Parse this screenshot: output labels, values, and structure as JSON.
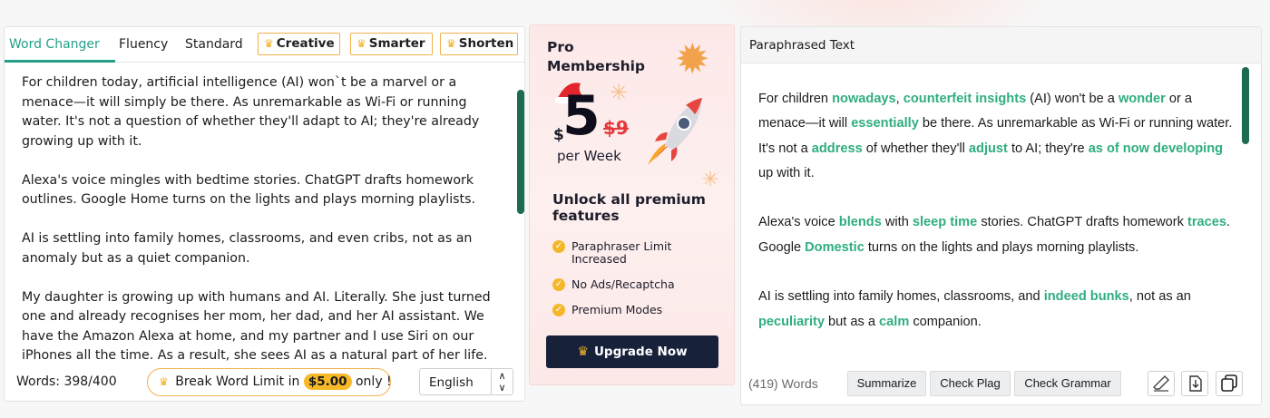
{
  "left": {
    "tabs": [
      {
        "label": "Word Changer",
        "active": true
      },
      {
        "label": "Fluency"
      },
      {
        "label": "Standard"
      },
      {
        "label": "Creative",
        "premium": true
      },
      {
        "label": "Smarter",
        "premium": true
      },
      {
        "label": "Shorten",
        "premium": true
      }
    ],
    "paragraphs": [
      "For children today, artificial intelligence (AI) won`t be a marvel or a menace—it will simply be there. As unremarkable as Wi-Fi or running water. It's not a question of whether they'll adapt to AI; they're already growing up with it.",
      "Alexa's voice mingles with bedtime stories. ChatGPT drafts homework outlines. Google Home turns on the lights and plays morning playlists.",
      "AI is settling into family homes, classrooms, and even cribs, not as an anomaly but as a quiet companion.",
      "My daughter is growing up with humans and AI. Literally. She just turned one and already recognises her mom, her dad, and her AI assistant. We have the Amazon Alexa at home, and my partner and I use Siri on our iPhones all the time. As a result, she sees AI as a natural part of her life. Alexa and Siri are two names she is familiar with, just like 'Mama' and 'Dada'."
    ],
    "word_count": "Words: 398/400",
    "break_limit_prefix": "Break Word Limit in",
    "break_limit_price": "$5.00",
    "break_limit_suffix": "only !",
    "language": "English"
  },
  "promo": {
    "title": "Pro Membership",
    "currency": "$",
    "price": "5",
    "old_price": "$9",
    "per": "per Week",
    "unlock": "Unlock all premium features",
    "features": [
      "Paraphraser Limit Increased",
      "No Ads/Recaptcha",
      "Premium Modes"
    ],
    "button": "Upgrade Now",
    "accent": "#f5b72a",
    "button_color": "#17213a"
  },
  "right": {
    "title": "Paraphrased Text",
    "paragraphs": [
      [
        {
          "t": "For children "
        },
        {
          "t": "nowadays",
          "h": true
        },
        {
          "t": ", "
        },
        {
          "t": "counterfeit insights",
          "h": true
        },
        {
          "t": " (AI) won't be a "
        },
        {
          "t": "wonder",
          "h": true
        },
        {
          "t": " or a menace—it will "
        },
        {
          "t": "essentially",
          "h": true
        },
        {
          "t": " be there. As unremarkable as Wi-Fi or running water. It's not a "
        },
        {
          "t": "address",
          "h": true
        },
        {
          "t": " of whether they'll "
        },
        {
          "t": "adjust",
          "h": true
        },
        {
          "t": " to AI; they're "
        },
        {
          "t": "as of now developing",
          "h": true
        },
        {
          "t": " up with it."
        }
      ],
      [
        {
          "t": "Alexa's voice "
        },
        {
          "t": "blends",
          "h": true
        },
        {
          "t": " with "
        },
        {
          "t": "sleep time",
          "h": true
        },
        {
          "t": " stories. ChatGPT drafts homework "
        },
        {
          "t": "traces",
          "h": true
        },
        {
          "t": ". Google "
        },
        {
          "t": "Domestic",
          "h": true
        },
        {
          "t": " turns on the lights and plays morning playlists."
        }
      ],
      [
        {
          "t": "AI is settling into family homes, classrooms, and "
        },
        {
          "t": "indeed bunks",
          "h": true
        },
        {
          "t": ", not as an "
        },
        {
          "t": "peculiarity",
          "h": true
        },
        {
          "t": " but as a "
        },
        {
          "t": "calm",
          "h": true
        },
        {
          "t": " companion."
        }
      ]
    ],
    "word_count": "(419) Words",
    "buttons": [
      "Summarize",
      "Check Plag",
      "Check Grammar"
    ],
    "highlight_color": "#2fae7e"
  }
}
